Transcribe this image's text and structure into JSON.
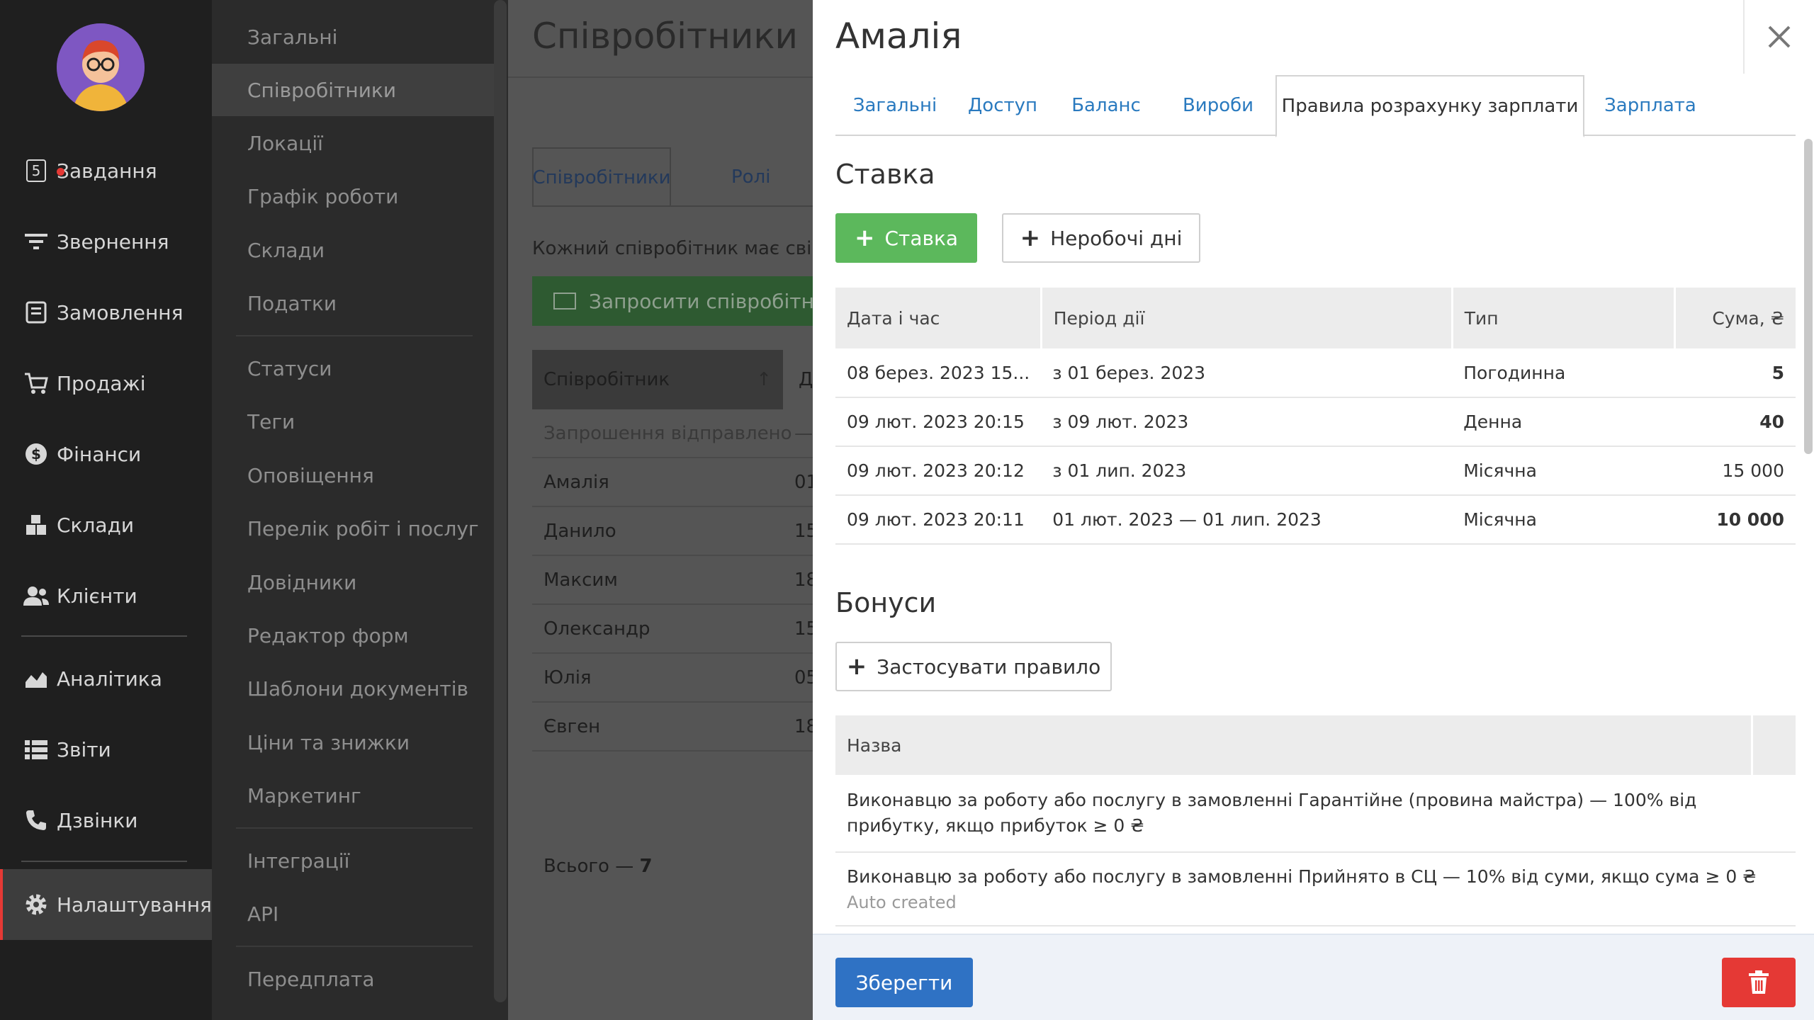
{
  "nav": {
    "items": [
      {
        "label": "Завдання",
        "icon": "tasks-icon",
        "badge": "5"
      },
      {
        "label": "Звернення",
        "icon": "filter-icon"
      },
      {
        "label": "Замовлення",
        "icon": "orders-icon"
      },
      {
        "label": "Продажі",
        "icon": "cart-icon"
      },
      {
        "label": "Фінанси",
        "icon": "dollar-icon"
      },
      {
        "label": "Склади",
        "icon": "warehouse-icon"
      },
      {
        "label": "Клієнти",
        "icon": "users-icon"
      },
      {
        "label": "Аналітика",
        "icon": "chart-icon"
      },
      {
        "label": "Звіти",
        "icon": "list-icon"
      },
      {
        "label": "Дзвінки",
        "icon": "phone-icon"
      },
      {
        "label": "Налаштування",
        "icon": "gear-icon"
      }
    ]
  },
  "submenu": {
    "items": [
      "Загальні",
      "Співробітники",
      "Локації",
      "Графік роботи",
      "Склади",
      "Податки",
      "Статуси",
      "Теги",
      "Оповіщення",
      "Перелік робіт і послуг",
      "Довідники",
      "Редактор форм",
      "Шаблони документів",
      "Ціни та знижки",
      "Маркетинг",
      "Інтеграції",
      "API",
      "Передплата"
    ]
  },
  "main": {
    "title": "Співробітники",
    "tabs": [
      "Співробітники",
      "Ролі"
    ],
    "description": "Кожний співробітник має свій ло",
    "invite_label": "Запросити співробітни",
    "table": {
      "headers": [
        "Співробітник",
        "Да"
      ],
      "rows": [
        {
          "name": "Запрошення відправлено",
          "date": "—"
        },
        {
          "name": "Амалія",
          "date": "01"
        },
        {
          "name": "Данило",
          "date": "15"
        },
        {
          "name": "Максим",
          "date": "18"
        },
        {
          "name": "Олександр",
          "date": "15"
        },
        {
          "name": "Юлія",
          "date": "05"
        },
        {
          "name": "Євген",
          "date": "18"
        }
      ]
    },
    "total_label": "Всього —",
    "total_value": "7"
  },
  "drawer": {
    "title": "Амалія",
    "tabs": [
      "Загальні",
      "Доступ",
      "Баланс",
      "Вироби",
      "Правила розрахунку зарплати",
      "Зарплата"
    ],
    "rate_section": {
      "title": "Ставка",
      "add_rate_label": "Ставка",
      "days_off_label": "Неробочі дні",
      "headers": [
        "Дата і час",
        "Період дії",
        "Тип",
        "Сума, ₴"
      ],
      "rows": [
        {
          "date": "08 берез. 2023 15...",
          "period": "з 01 берез. 2023",
          "type": "Погодинна",
          "amount": "5"
        },
        {
          "date": "09 лют. 2023 20:15",
          "period": "з 09 лют. 2023",
          "type": "Денна",
          "amount": "40"
        },
        {
          "date": "09 лют. 2023 20:12",
          "period": "з 01 лип. 2023",
          "type": "Місячна",
          "amount": "15 000"
        },
        {
          "date": "09 лют. 2023 20:11",
          "period": "01 лют. 2023 — 01 лип. 2023",
          "type": "Місячна",
          "amount": "10 000"
        }
      ]
    },
    "bonus_section": {
      "title": "Бонуси",
      "apply_rule_label": "Застосувати правило",
      "header": "Назва",
      "rows": [
        {
          "text": "Виконавцю за роботу або послугу в замовленні Гарантійне (провина майстра) — 100% від прибутку, якщо прибуток ≥ 0 ₴",
          "sub": ""
        },
        {
          "text": "Виконавцю за роботу або послугу в замовленні Прийнято в СЦ — 10% від суми, якщо сума ≥ 0 ₴",
          "sub": "Auto created"
        }
      ]
    },
    "save_label": "Зберегти"
  },
  "colors": {
    "accent_blue": "#2f72c4",
    "green": "#5cb85c",
    "danger": "#e53935",
    "link": "#2a7abf"
  }
}
